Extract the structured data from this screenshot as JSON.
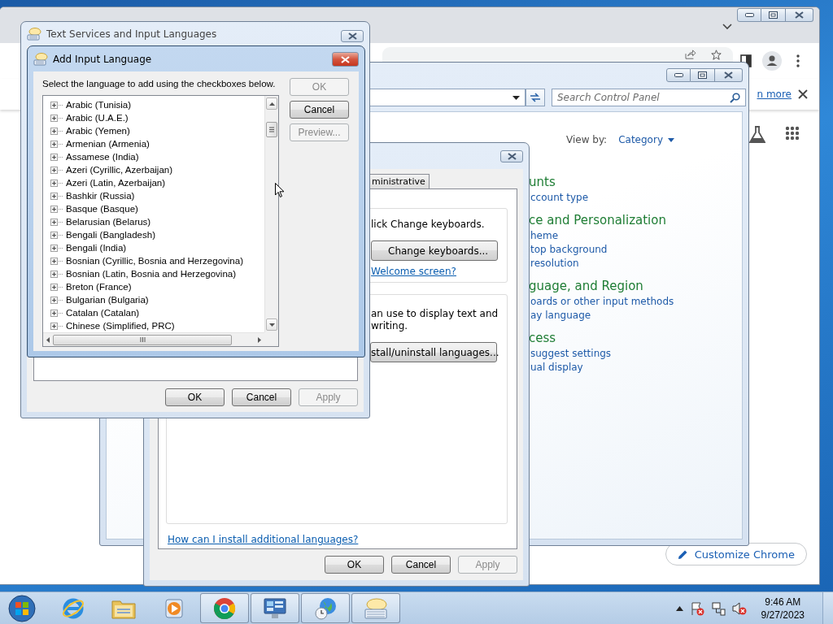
{
  "browser": {
    "infobar_link": "n more",
    "customize_button": "Customize Chrome"
  },
  "control_panel": {
    "search_placeholder": "Search Control Panel",
    "view_by_label": "View by:",
    "view_by_value": "Category",
    "categories": [
      {
        "heading": "unts",
        "links": [
          "ccount type"
        ]
      },
      {
        "heading": "ce and Personalization",
        "links": [
          "heme",
          "top background",
          "resolution"
        ]
      },
      {
        "heading": "guage, and Region",
        "links": [
          "oards or other input methods",
          "ay language"
        ]
      },
      {
        "heading": "cess",
        "links": [
          "suggest settings",
          "ual display"
        ]
      }
    ]
  },
  "region_dialog": {
    "tabs": [
      {
        "label": "ministrative",
        "selected": false
      }
    ],
    "groups": [
      {
        "lines": [
          "lick Change keyboards."
        ],
        "button": "Change keyboards...",
        "link": "Welcome screen?"
      },
      {
        "lines": [
          "an use to display text and",
          "writing."
        ],
        "button": "stall/uninstall languages..."
      }
    ],
    "help_link": "How can I install additional languages?",
    "buttons": [
      {
        "label": "OK",
        "disabled": false
      },
      {
        "label": "Cancel",
        "disabled": false
      },
      {
        "label": "Apply",
        "disabled": true
      }
    ]
  },
  "text_services": {
    "title": "Text Services and Input Languages",
    "buttons": [
      {
        "label": "OK",
        "disabled": false
      },
      {
        "label": "Cancel",
        "disabled": false
      },
      {
        "label": "Apply",
        "disabled": true
      }
    ]
  },
  "add_input_language": {
    "title": "Add Input Language",
    "instruction": "Select the language to add using the checkboxes below.",
    "languages": [
      {
        "name": "Arabic (Tunisia)",
        "expanded": false
      },
      {
        "name": "Arabic (U.A.E.)",
        "expanded": false
      },
      {
        "name": "Arabic (Yemen)",
        "expanded": false
      },
      {
        "name": "Armenian (Armenia)",
        "expanded": false
      },
      {
        "name": "Assamese (India)",
        "expanded": false
      },
      {
        "name": "Azeri (Cyrillic, Azerbaijan)",
        "expanded": false
      },
      {
        "name": "Azeri (Latin, Azerbaijan)",
        "expanded": false
      },
      {
        "name": "Bashkir (Russia)",
        "expanded": false
      },
      {
        "name": "Basque (Basque)",
        "expanded": false
      },
      {
        "name": "Belarusian (Belarus)",
        "expanded": false
      },
      {
        "name": "Bengali (Bangladesh)",
        "expanded": false
      },
      {
        "name": "Bengali (India)",
        "expanded": false
      },
      {
        "name": "Bosnian (Cyrillic, Bosnia and Herzegovina)",
        "expanded": false
      },
      {
        "name": "Bosnian (Latin, Bosnia and Herzegovina)",
        "expanded": false
      },
      {
        "name": "Breton (France)",
        "expanded": false
      },
      {
        "name": "Bulgarian (Bulgaria)",
        "expanded": false
      },
      {
        "name": "Catalan (Catalan)",
        "expanded": false
      },
      {
        "name": "Chinese (Simplified, PRC)",
        "expanded": false
      }
    ],
    "buttons": [
      {
        "label": "OK",
        "disabled": true
      },
      {
        "label": "Cancel",
        "disabled": false
      },
      {
        "label": "Preview...",
        "disabled": true
      }
    ]
  },
  "taskbar": {
    "apps": [
      {
        "kind": "ie",
        "running": false
      },
      {
        "kind": "explorer",
        "running": false
      },
      {
        "kind": "media",
        "running": false
      },
      {
        "kind": "chrome",
        "running": true
      },
      {
        "kind": "control",
        "running": true
      },
      {
        "kind": "clock",
        "running": true
      },
      {
        "kind": "keyboard",
        "running": true
      }
    ],
    "time": "9:46 AM",
    "date": "9/27/2023"
  }
}
